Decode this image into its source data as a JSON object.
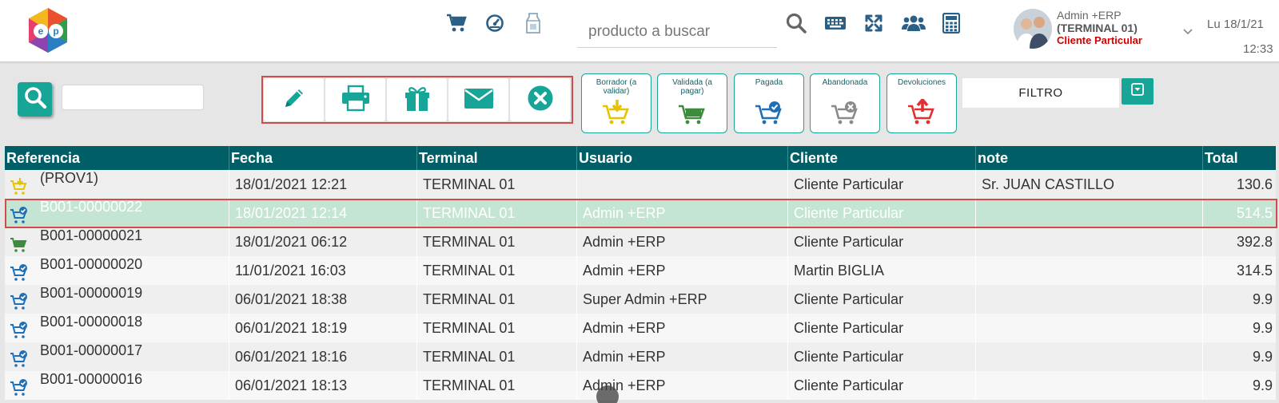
{
  "app": {
    "logo": "erp-logo",
    "colors": {
      "teal": "#16a597",
      "dark_teal": "#005f66",
      "highlight_red": "#d24a4a",
      "client_red": "#d00000"
    }
  },
  "header": {
    "icons": [
      "cart-icon",
      "tachometer-icon",
      "milk-carton-icon",
      "search-icon",
      "keyboard-icon",
      "expand-icon",
      "users-icon",
      "calculator-icon",
      "chevron-down-icon"
    ],
    "search": {
      "placeholder": "producto a buscar",
      "value": ""
    },
    "user": {
      "name": "Admin +ERP",
      "terminal": "(TERMINAL 01)",
      "client": "Cliente Particular"
    },
    "date": "Lu 18/1/21",
    "time": "12:33"
  },
  "toolbar": {
    "search_value": "",
    "actions": [
      {
        "name": "edit-button",
        "icon": "pencil-icon"
      },
      {
        "name": "print-button",
        "icon": "printer-icon"
      },
      {
        "name": "gift-button",
        "icon": "gift-icon"
      },
      {
        "name": "email-button",
        "icon": "envelope-icon"
      },
      {
        "name": "cancel-button",
        "icon": "times-circle-icon"
      }
    ],
    "statuses": [
      {
        "label": "Borrador (a validar)",
        "icon": "cart-download-icon",
        "color": "#e6c200"
      },
      {
        "label": "Validada (a pagar)",
        "icon": "cart-icon",
        "color": "#3d8b3d"
      },
      {
        "label": "Pagada",
        "icon": "cart-check-icon",
        "color": "#1e6fb8"
      },
      {
        "label": "Abandonada",
        "icon": "cart-times-icon",
        "color": "#8a8a8a"
      },
      {
        "label": "Devoluciones",
        "icon": "cart-upload-icon",
        "color": "#e03030"
      }
    ],
    "filter_label": "FILTRO"
  },
  "table": {
    "columns": [
      "Referencia",
      "Fecha",
      "Terminal",
      "Usuario",
      "Cliente",
      "note",
      "Total"
    ],
    "rows": [
      {
        "status": "draft",
        "ref": "(PROV1)",
        "fecha": "18/01/2021 12:21",
        "terminal": "TERMINAL 01",
        "usuario": "",
        "cliente": "Cliente Particular",
        "note": "Sr. JUAN CASTILLO",
        "total": "130.6"
      },
      {
        "status": "paid",
        "ref": "B001-00000022",
        "fecha": "18/01/2021 12:14",
        "terminal": "TERMINAL 01",
        "usuario": "Admin +ERP",
        "cliente": "Cliente Particular",
        "note": "",
        "total": "514.5",
        "selected": true
      },
      {
        "status": "validated",
        "ref": "B001-00000021",
        "fecha": "18/01/2021 06:12",
        "terminal": "TERMINAL 01",
        "usuario": "Admin +ERP",
        "cliente": "Cliente Particular",
        "note": "",
        "total": "392.8"
      },
      {
        "status": "paid",
        "ref": "B001-00000020",
        "fecha": "11/01/2021 16:03",
        "terminal": "TERMINAL 01",
        "usuario": "Admin +ERP",
        "cliente": "Martin BIGLIA",
        "note": "",
        "total": "314.5"
      },
      {
        "status": "paid",
        "ref": "B001-00000019",
        "fecha": "06/01/2021 18:38",
        "terminal": "TERMINAL 01",
        "usuario": "Super Admin +ERP",
        "cliente": "Cliente Particular",
        "note": "",
        "total": "9.9"
      },
      {
        "status": "paid",
        "ref": "B001-00000018",
        "fecha": "06/01/2021 18:19",
        "terminal": "TERMINAL 01",
        "usuario": "Admin +ERP",
        "cliente": "Cliente Particular",
        "note": "",
        "total": "9.9"
      },
      {
        "status": "paid",
        "ref": "B001-00000017",
        "fecha": "06/01/2021 18:16",
        "terminal": "TERMINAL 01",
        "usuario": "Admin +ERP",
        "cliente": "Cliente Particular",
        "note": "",
        "total": "9.9"
      },
      {
        "status": "paid",
        "ref": "B001-00000016",
        "fecha": "06/01/2021 18:13",
        "terminal": "TERMINAL 01",
        "usuario": "Admin +ERP",
        "cliente": "Cliente Particular",
        "note": "",
        "total": "9.9"
      }
    ]
  }
}
